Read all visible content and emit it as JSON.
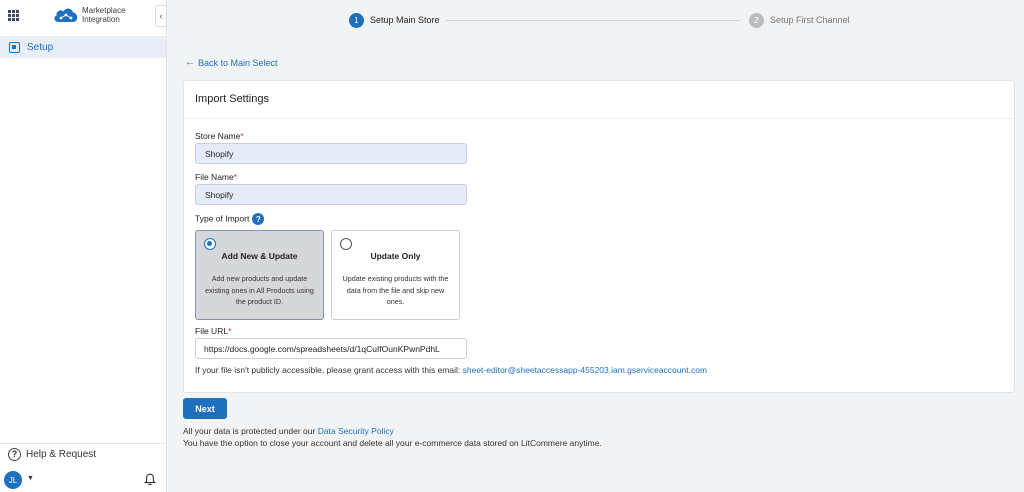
{
  "sidebar": {
    "logo_line1": "Marketplace",
    "logo_line2": "Integration",
    "collapse_glyph": "‹",
    "items": [
      {
        "label": "Setup",
        "icon": "setup-icon"
      }
    ],
    "help_label": "Help & Request",
    "avatar_initials": "JL"
  },
  "stepper": {
    "steps": [
      {
        "number": "1",
        "label": "Setup Main Store",
        "state": "active"
      },
      {
        "number": "2",
        "label": "Setup First Channel",
        "state": "pending"
      }
    ]
  },
  "back_link": "Back to Main Select",
  "import_settings": {
    "title": "Import Settings",
    "store_name_label": "Store Name",
    "store_name_value": "Shopify",
    "file_name_label": "File Name",
    "file_name_value": "Shopify",
    "required_mark": "*",
    "type_label": "Type of Import",
    "help_glyph": "?",
    "options": [
      {
        "title": "Add New & Update",
        "description": "Add new products and update existing ones in All Products using the product ID.",
        "selected": true
      },
      {
        "title": "Update Only",
        "description": "Update existing products with the data from the file and skip new ones.",
        "selected": false
      }
    ],
    "file_url_label": "File URL",
    "file_url_value": "https://docs.google.com/spreadsheets/d/1qCuIfOunKPwnPdhL",
    "access_note": "If your file isn't publicly accessible, please grant access with this email:",
    "access_email": "sheet-editor@sheetaccessapp-455203.iam.gserviceaccount.com"
  },
  "next_button": "Next",
  "footer": {
    "security_text": "All your data is protected under our",
    "security_link": "Data Security Policy",
    "account_text": "You have the option to close your account and delete all your e-commerce data stored on LitCommere anytime."
  },
  "colors": {
    "accent": "#1f6fbf",
    "selected_card_bg": "#d6d7da",
    "input_bg": "#e6ebfa",
    "page_bg": "#f2f3f5"
  }
}
